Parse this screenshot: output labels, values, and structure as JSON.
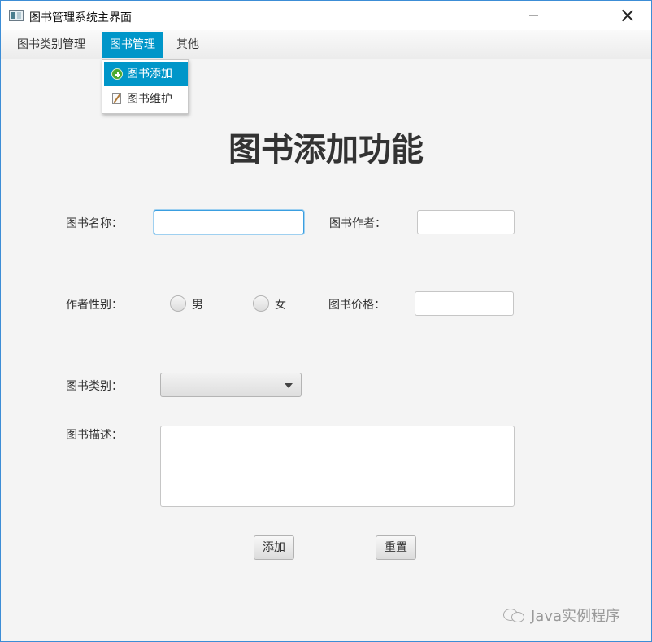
{
  "window": {
    "title": "图书管理系统主界面",
    "icon": "app-window-icon"
  },
  "menubar": {
    "items": [
      {
        "label": "图书类别管理"
      },
      {
        "label": "图书管理"
      },
      {
        "label": "其他"
      }
    ],
    "active_index": 1
  },
  "dropdown": {
    "items": [
      {
        "label": "图书添加",
        "icon": "add-circle-icon"
      },
      {
        "label": "图书维护",
        "icon": "edit-document-icon"
      }
    ],
    "highlighted_index": 0
  },
  "form": {
    "title": "图书添加功能",
    "book_name_label": "图书名称：",
    "book_name_value": "",
    "author_label": "图书作者：",
    "author_value": "",
    "gender_label": "作者性别：",
    "gender_options": [
      "男",
      "女"
    ],
    "price_label": "图书价格：",
    "price_value": "",
    "category_label": "图书类别：",
    "category_value": "",
    "description_label": "图书描述：",
    "description_value": "",
    "add_button": "添加",
    "reset_button": "重置"
  },
  "watermark": {
    "text": "Java实例程序"
  },
  "colors": {
    "accent": "#0096c9",
    "focus_border": "#3a9ee0",
    "background": "#f4f4f4"
  }
}
